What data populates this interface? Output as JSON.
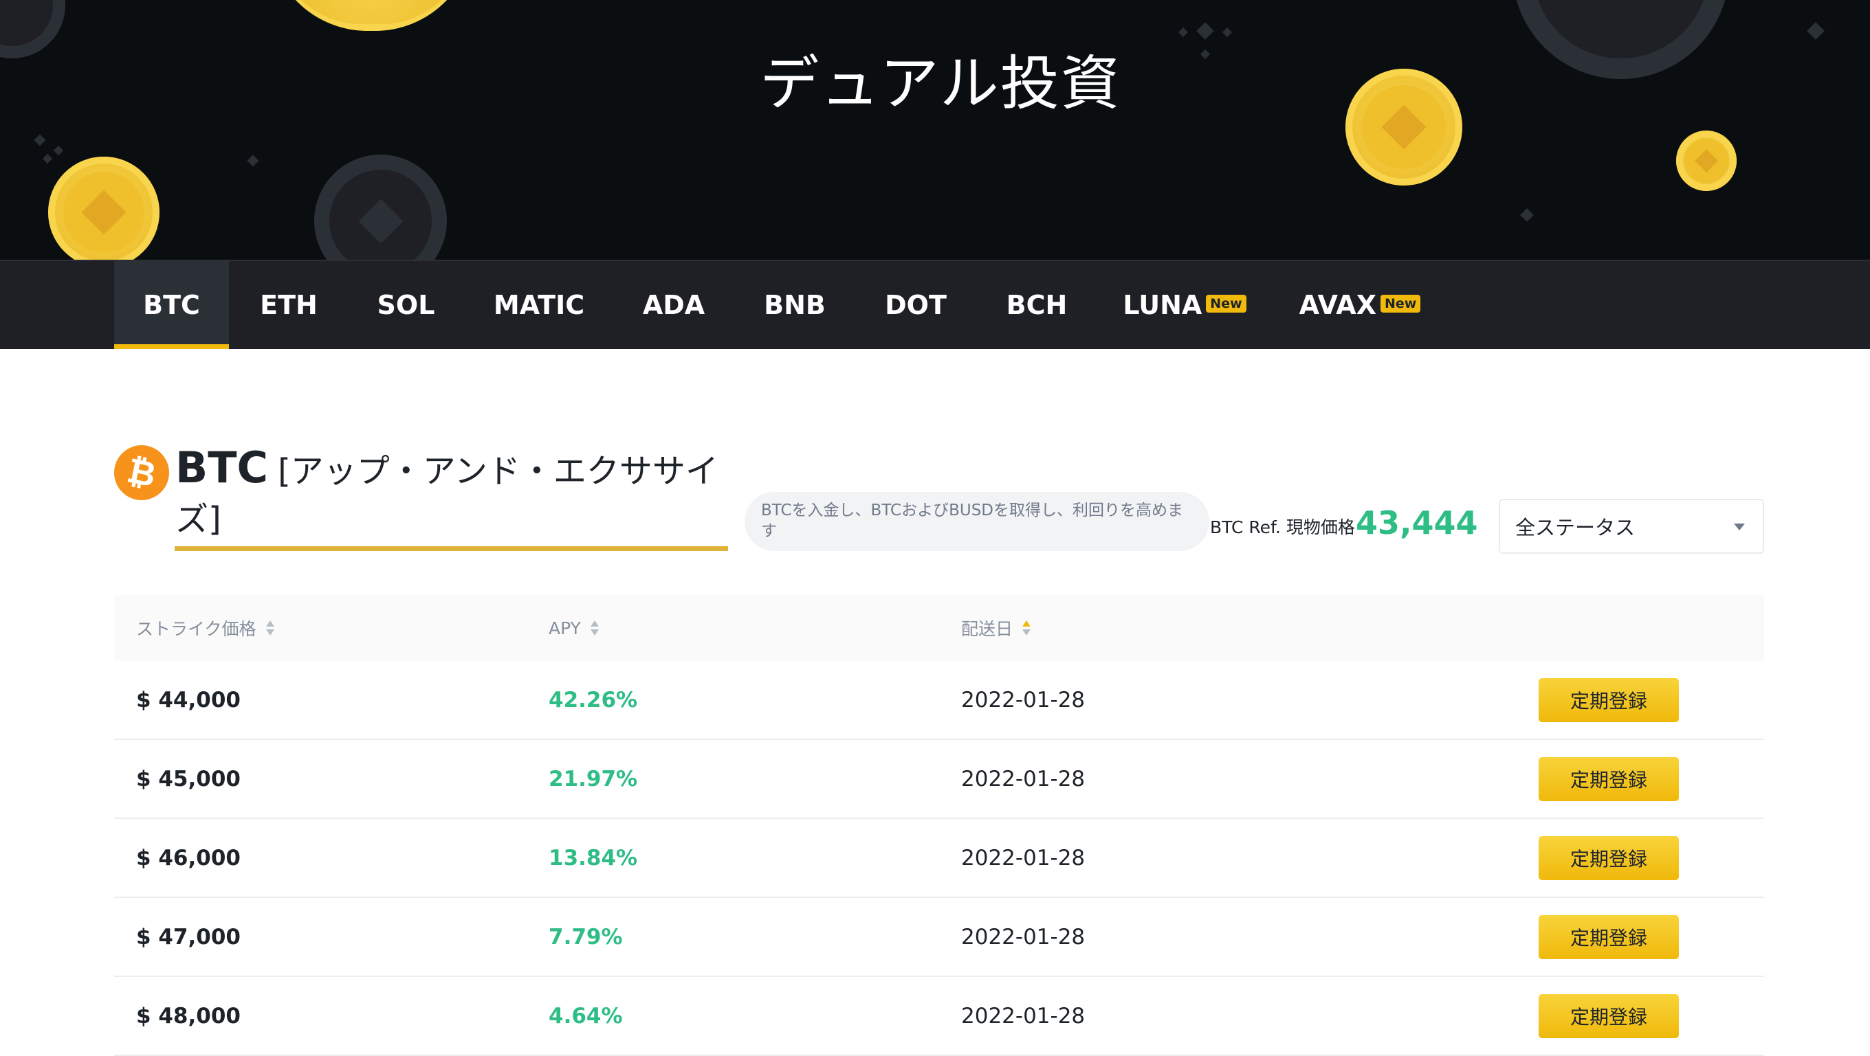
{
  "hero": {
    "title": "デュアル投資"
  },
  "tabs": [
    {
      "label": "BTC",
      "active": true,
      "new": false
    },
    {
      "label": "ETH",
      "active": false,
      "new": false
    },
    {
      "label": "SOL",
      "active": false,
      "new": false
    },
    {
      "label": "MATIC",
      "active": false,
      "new": false
    },
    {
      "label": "ADA",
      "active": false,
      "new": false
    },
    {
      "label": "BNB",
      "active": false,
      "new": false
    },
    {
      "label": "DOT",
      "active": false,
      "new": false
    },
    {
      "label": "BCH",
      "active": false,
      "new": false
    },
    {
      "label": "LUNA",
      "active": false,
      "new": true,
      "badge": "New"
    },
    {
      "label": "AVAX",
      "active": false,
      "new": true,
      "badge": "New"
    }
  ],
  "product": {
    "logo_icon": "bitcoin-icon",
    "logo_glyph": "₿",
    "coin": "BTC",
    "name_line1": "[アップ・アンド・エクササイ",
    "name_line2": "ズ]",
    "description": "BTCを入金し、BTCおよびBUSDを取得し、利回りを高めます",
    "ref_label": "BTC Ref. 現物価格",
    "ref_price": "43,444"
  },
  "filter": {
    "selected": "全ステータス",
    "icon": "caret-down-icon"
  },
  "table": {
    "headers": {
      "strike": "ストライク価格",
      "apy": "APY",
      "date": "配送日"
    },
    "rows": [
      {
        "strike": "$ 44,000",
        "apy": "42.26%",
        "date": "2022-01-28",
        "action": "定期登録"
      },
      {
        "strike": "$ 45,000",
        "apy": "21.97%",
        "date": "2022-01-28",
        "action": "定期登録"
      },
      {
        "strike": "$ 46,000",
        "apy": "13.84%",
        "date": "2022-01-28",
        "action": "定期登録"
      },
      {
        "strike": "$ 47,000",
        "apy": "7.79%",
        "date": "2022-01-28",
        "action": "定期登録"
      },
      {
        "strike": "$ 48,000",
        "apy": "4.64%",
        "date": "2022-01-28",
        "action": "定期登録"
      }
    ]
  },
  "colors": {
    "accent": "#f0b90b",
    "positive": "#2ebd85",
    "hero_bg": "#0b0e11",
    "tabbar_bg": "#1e2026",
    "btc_orange": "#f7931a"
  }
}
